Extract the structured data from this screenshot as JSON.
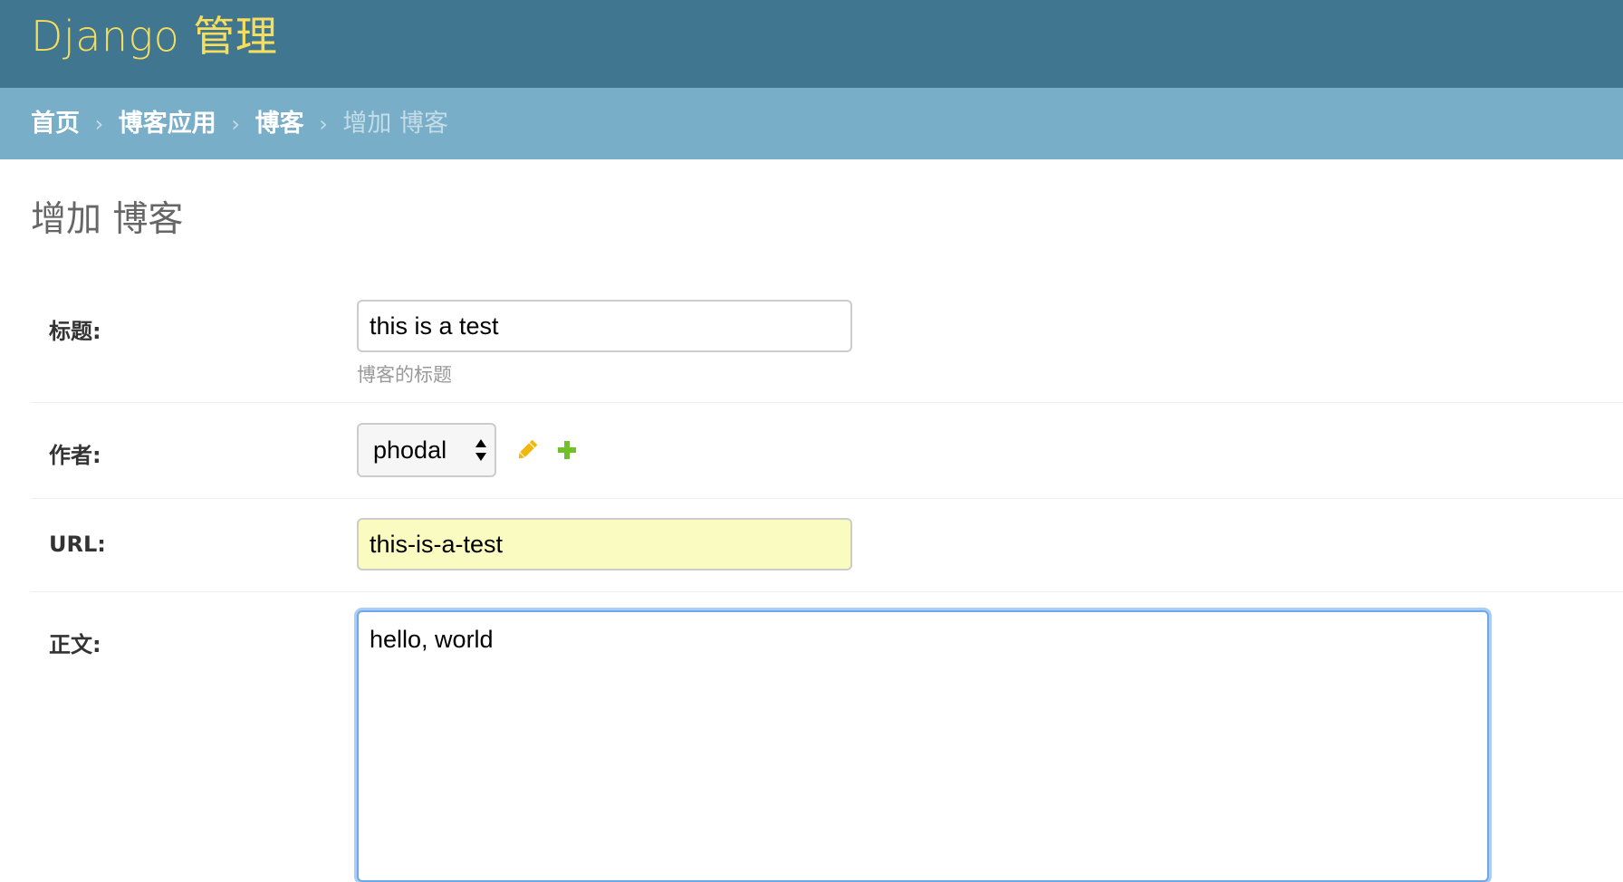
{
  "header": {
    "branding": "Django 管理"
  },
  "breadcrumbs": {
    "items": [
      "首页",
      "博客应用",
      "博客"
    ],
    "current": "增加 博客",
    "separator": "›"
  },
  "page": {
    "title": "增加 博客"
  },
  "form": {
    "title": {
      "label": "标题:",
      "value": "this is a test",
      "help": "博客的标题"
    },
    "author": {
      "label": "作者:",
      "selected": "phodal",
      "edit_icon": "pencil-icon",
      "add_icon": "plus-icon"
    },
    "url": {
      "label": "URL:",
      "value": "this-is-a-test"
    },
    "content": {
      "label": "正文:",
      "value": "hello, world"
    }
  },
  "colors": {
    "header_bg": "#417690",
    "branding": "#f5dd5d",
    "breadcrumbs_bg": "#79aec8",
    "url_field_bg": "#fafbc1",
    "edit_icon": "#efb80b",
    "add_icon": "#70bf2b",
    "focus_ring": "#6fa8e8"
  }
}
